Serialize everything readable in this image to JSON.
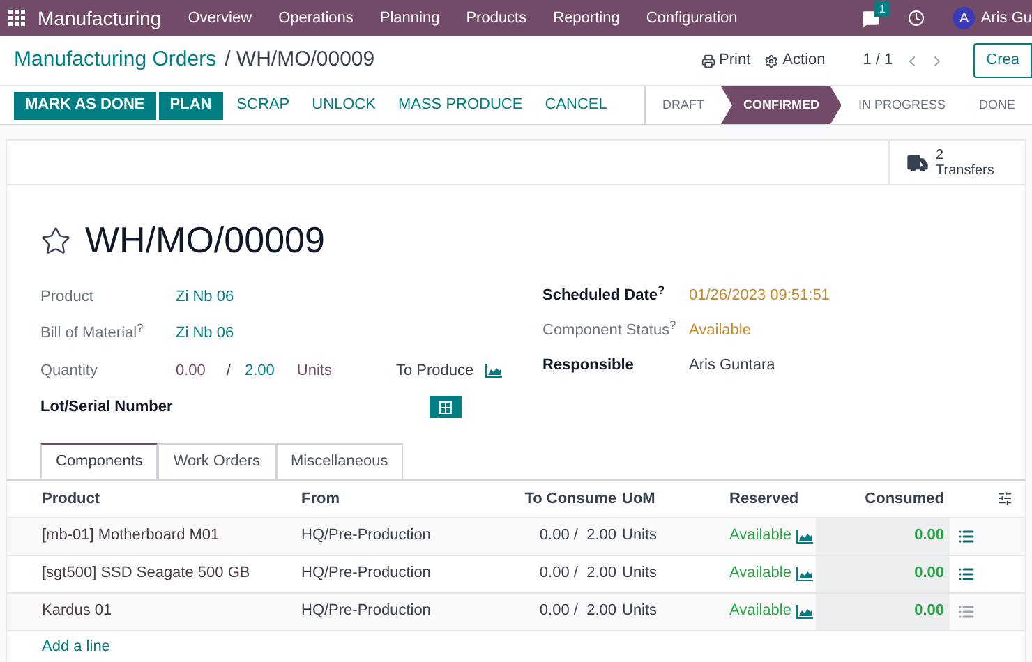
{
  "nav": {
    "app": "Manufacturing",
    "menu": [
      "Overview",
      "Operations",
      "Planning",
      "Products",
      "Reporting",
      "Configuration"
    ],
    "messages_badge": "1",
    "avatar_letter": "A",
    "user": "Aris Gu"
  },
  "breadcrumb": {
    "parent": "Manufacturing Orders",
    "separator": "/",
    "current": "WH/MO/00009"
  },
  "toolbar": {
    "print": "Print",
    "action": "Action",
    "pager": "1 / 1",
    "create": "Crea"
  },
  "actions": [
    {
      "label": "MARK AS DONE",
      "kind": "primary"
    },
    {
      "label": "PLAN",
      "kind": "primary"
    },
    {
      "label": "SCRAP",
      "kind": "link"
    },
    {
      "label": "UNLOCK",
      "kind": "link"
    },
    {
      "label": "MASS PRODUCE",
      "kind": "link"
    },
    {
      "label": "CANCEL",
      "kind": "link"
    }
  ],
  "stages": [
    {
      "label": "DRAFT",
      "selected": false
    },
    {
      "label": "CONFIRMED",
      "selected": true
    },
    {
      "label": "IN PROGRESS",
      "selected": false
    },
    {
      "label": "DONE",
      "selected": false
    }
  ],
  "smart_button": {
    "count": "2",
    "label": "Transfers"
  },
  "record": {
    "title": "WH/MO/00009",
    "starred": false,
    "left": [
      {
        "label": "Product",
        "value": "Zi Nb 06"
      },
      {
        "label": "Bill of Material$^{?}$",
        "value": "Zi Nb 06"
      }
    ],
    "quantity": {
      "label": "Quantity",
      "produced": "0.00",
      "separator": "/",
      "total": "2.00",
      "unit": "Units",
      "to_produce": "To Produce"
    },
    "lot": {
      "label": "Lot/Serial Number"
    },
    "right": [
      {
        "label": "Scheduled Date$^{?}$",
        "value": "01/26/2023 09:51:51",
        "bold": true
      },
      {
        "label": "Component Status$^{?}$",
        "value": "Available",
        "bold": false
      },
      {
        "label": "Responsible",
        "value": "Aris Guntara",
        "bold": true
      }
    ]
  },
  "tabs": [
    {
      "label": "Components",
      "selected": true
    },
    {
      "label": "Work Orders",
      "selected": false
    },
    {
      "label": "Miscellaneous",
      "selected": false
    }
  ],
  "table": {
    "columns": [
      "Product",
      "From",
      "To Consume",
      "UoM",
      "Reserved",
      "Consumed"
    ],
    "rows": [
      {
        "product": "[mb-01] Motherboard M01",
        "from": "HQ/Pre-Production",
        "consumed_of": "0.00 /",
        "to_consume": "2.00",
        "uom": "Units",
        "reserved": "Available",
        "consumed": "0.00",
        "details_active": true
      },
      {
        "product": "[sgt500] SSD Seagate 500 GB",
        "from": "HQ/Pre-Production",
        "consumed_of": "0.00 /",
        "to_consume": "2.00",
        "uom": "Units",
        "reserved": "Available",
        "consumed": "0.00",
        "details_active": true
      },
      {
        "product": "Kardus 01",
        "from": "HQ/Pre-Production",
        "consumed_of": "0.00 /",
        "to_consume": "2.00",
        "uom": "Units",
        "reserved": "Available",
        "consumed": "0.00",
        "details_active": false
      }
    ],
    "add_line": "Add a line"
  }
}
